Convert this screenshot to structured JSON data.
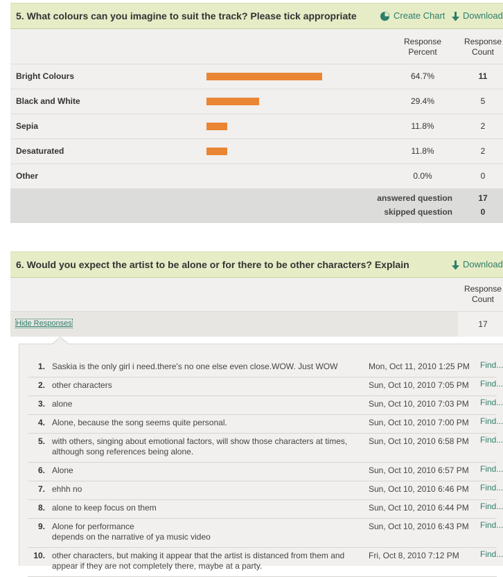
{
  "q5": {
    "title": "5. What colours can you imagine to suit the track? Please tick appropriate",
    "create_chart": "Create Chart",
    "download": "Download",
    "hdr_percent_line1": "Response",
    "hdr_percent_line2": "Percent",
    "hdr_count_line1": "Response",
    "hdr_count_line2": "Count",
    "rows": [
      {
        "label": "Bright Colours",
        "percent": "64.7%",
        "percent_value": 64.7,
        "count": "11"
      },
      {
        "label": "Black and White",
        "percent": "29.4%",
        "percent_value": 29.4,
        "count": "5"
      },
      {
        "label": "Sepia",
        "percent": "11.8%",
        "percent_value": 11.8,
        "count": "2"
      },
      {
        "label": "Desaturated",
        "percent": "11.8%",
        "percent_value": 11.8,
        "count": "2"
      },
      {
        "label": "Other",
        "percent": "0.0%",
        "percent_value": 0.0,
        "count": "0"
      }
    ],
    "answered_label": "answered question",
    "answered_value": "17",
    "skipped_label": "skipped question",
    "skipped_value": "0",
    "bar_color": "#ea8534"
  },
  "q6": {
    "title": "6. Would you expect the artist to be alone or for there to be other characters? Explain",
    "download": "Download",
    "hdr_count_line1": "Response",
    "hdr_count_line2": "Count",
    "hide_responses": "Hide Responses",
    "count": "17",
    "responses": [
      {
        "num": "1.",
        "text": "Saskia is the only girl i need.there's no one else even close.WOW. Just WOW",
        "date": "Mon, Oct 11, 2010 1:25 PM",
        "find": "Find..."
      },
      {
        "num": "2.",
        "text": "other characters",
        "date": "Sun, Oct 10, 2010 7:05 PM",
        "find": "Find..."
      },
      {
        "num": "3.",
        "text": "alone",
        "date": "Sun, Oct 10, 2010 7:03 PM",
        "find": "Find..."
      },
      {
        "num": "4.",
        "text": "Alone, because the song seems quite personal.",
        "date": "Sun, Oct 10, 2010 7:00 PM",
        "find": "Find..."
      },
      {
        "num": "5.",
        "text": "with others, singing about emotional factors, will show those characters at times, although song references being alone.",
        "date": "Sun, Oct 10, 2010 6:58 PM",
        "find": "Find..."
      },
      {
        "num": "6.",
        "text": "Alone",
        "date": "Sun, Oct 10, 2010 6:57 PM",
        "find": "Find..."
      },
      {
        "num": "7.",
        "text": "ehhh no",
        "date": "Sun, Oct 10, 2010 6:46 PM",
        "find": "Find..."
      },
      {
        "num": "8.",
        "text": "alone to keep focus on them",
        "date": "Sun, Oct 10, 2010 6:44 PM",
        "find": "Find..."
      },
      {
        "num": "9.",
        "text": "Alone for performance\ndepends on the narrative of ya music video",
        "date": "Sun, Oct 10, 2010 6:43 PM",
        "find": "Find..."
      },
      {
        "num": "10.",
        "text": "other characters, but making it appear that the artist is distanced from them and appear if they are not completely there, maybe at a party.",
        "date": "Fri, Oct 8, 2010 7:12 PM",
        "find": "Find..."
      }
    ]
  },
  "icons": {
    "create_chart": "pie-chart-icon",
    "download": "download-arrow-icon"
  },
  "colors": {
    "title_bar": "#e6ecc6",
    "link": "#2e7e6a",
    "panel": "#f1f0ee",
    "summary": "#dcdcda"
  }
}
